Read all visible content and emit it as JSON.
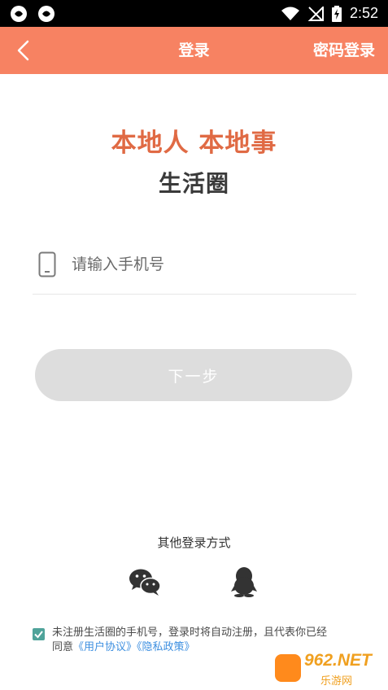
{
  "status_bar": {
    "time": "2:52"
  },
  "app_bar": {
    "title": "登录",
    "password_login": "密码登录"
  },
  "hero": {
    "slogan": "本地人 本地事",
    "app_name": "生活圈"
  },
  "phone_field": {
    "placeholder": "请输入手机号",
    "value": ""
  },
  "next_button": {
    "label": "下一步"
  },
  "other_login": {
    "title": "其他登录方式"
  },
  "agreement": {
    "checked": true,
    "text_part1": "未注册生活圈的手机号，登录时将自动注册，且代表你已经同意",
    "user_agreement": "《用户协议》",
    "privacy_policy": "《隐私政策》"
  },
  "watermark": {
    "number": "962.NET",
    "name": "乐游网"
  },
  "colors": {
    "accent": "#f78262",
    "slogan": "#e06a44",
    "link": "#3d8fe0",
    "checkbox": "#4fa39a",
    "button_disabled": "#dddddd"
  }
}
